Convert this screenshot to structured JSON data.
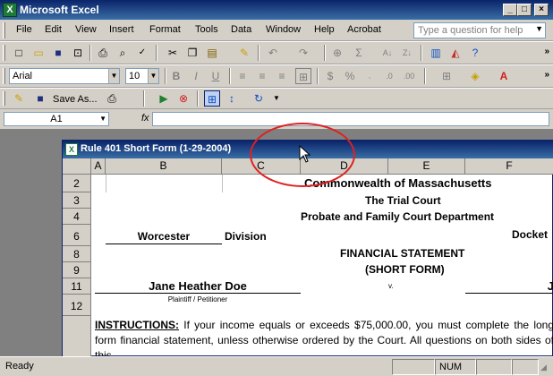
{
  "app": {
    "title": "Microsoft Excel"
  },
  "window_controls": {
    "minimize": "_",
    "restore": "□",
    "close": "×"
  },
  "menu": [
    "File",
    "Edit",
    "View",
    "Insert",
    "Format",
    "Tools",
    "Data",
    "Window",
    "Help",
    "Acrobat"
  ],
  "help_search": {
    "placeholder": "Type a question for help"
  },
  "toolbar": {
    "font_name": "Arial",
    "font_size": "10",
    "bold_label": "B",
    "italic_label": "I",
    "underline_label": "U",
    "save_as_label": "Save As..."
  },
  "icons": [
    "new-icon",
    "open-icon",
    "save-icon",
    "permission-icon",
    "print-icon",
    "print-preview-icon",
    "spelling-icon",
    "cut-icon",
    "copy-icon",
    "paste-icon",
    "format-painter-icon",
    "undo-icon",
    "redo-icon",
    "hyperlink-icon",
    "autosum-icon",
    "sort-ascending-icon",
    "sort-descending-icon",
    "chart-wizard-icon",
    "drawing-icon",
    "zoom-icon",
    "help-icon"
  ],
  "formula_bar": {
    "name_box": "A1",
    "fx": "fx",
    "value": ""
  },
  "document": {
    "title": "Rule 401 Short Form (1-29-2004)",
    "columns": [
      "A",
      "B",
      "C",
      "D",
      "E",
      "F"
    ],
    "rows": [
      "2",
      "3",
      "4",
      "6",
      "8",
      "9",
      "11",
      "12"
    ],
    "cells": {
      "commonwealth": "Commonwealth of Massachusetts",
      "trial_court": "The Trial Court",
      "department": "Probate and Family Court Department",
      "county": "Worcester",
      "division": "Division",
      "docket": "Docket",
      "form_title": "FINANCIAL STATEMENT",
      "form_subtitle": "(SHORT FORM)",
      "plaintiff_name": "Jane Heather Doe",
      "plaintiff_label": "Plaintiff / Petitioner",
      "versus": "v.",
      "defendant_initial": "J",
      "instructions_heading": "INSTRUCTIONS:",
      "instructions_text": " If your income equals or exceeds $75,000.00, you must complete the long form financial statement, unless otherwise ordered by the Court. All questions on both sides of this"
    }
  },
  "status": {
    "ready": "Ready",
    "num": "NUM"
  },
  "colors": {
    "title_bar": "#0a246a",
    "annotation": "#e02020",
    "workspace": "#808080"
  }
}
